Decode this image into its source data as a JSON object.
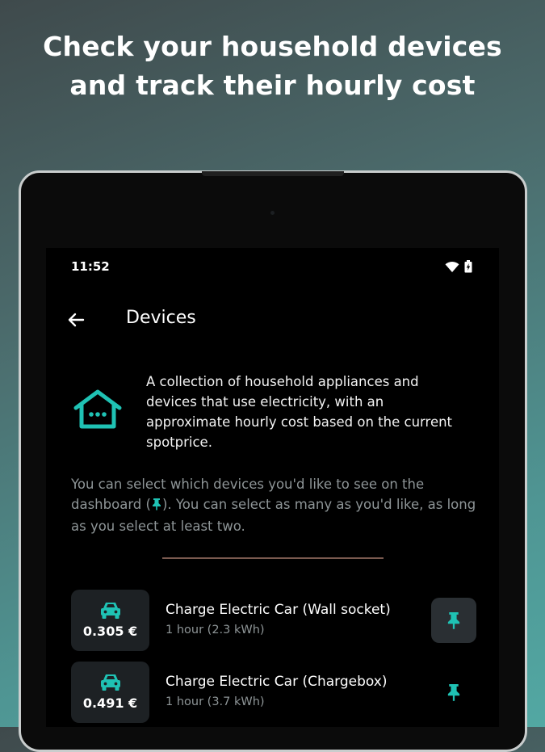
{
  "headline": {
    "line1": "Check your household devices",
    "line2": "and track their hourly cost"
  },
  "status_bar": {
    "time": "11:52",
    "icons": [
      "wifi-icon",
      "battery-charging-icon"
    ]
  },
  "app_bar": {
    "back_icon": "arrow-back-icon",
    "title": "Devices"
  },
  "intro": {
    "icon": "house-icon",
    "text": "A collection of household appliances and devices that use electricity, with an approximate hourly cost based on the current spotprice."
  },
  "hint": {
    "before": "You can select which devices you'd like to see on the dashboard (",
    "after": "). You can select as many as you'd like, as long as you select at least two."
  },
  "devices": [
    {
      "icon": "car-icon",
      "price": "0.305 €",
      "name": "Charge Electric Car (Wall socket)",
      "detail": "1 hour (2.3 kWh)",
      "pinned": true
    },
    {
      "icon": "car-icon",
      "price": "0.491 €",
      "name": "Charge Electric Car (Chargebox)",
      "detail": "1 hour (3.7 kWh)",
      "pinned": false
    }
  ],
  "colors": {
    "accent": "#1fc2b4",
    "background": "#000000",
    "card": "#1d2124",
    "muted_text": "#8e9597",
    "divider": "#7a5a4f"
  }
}
